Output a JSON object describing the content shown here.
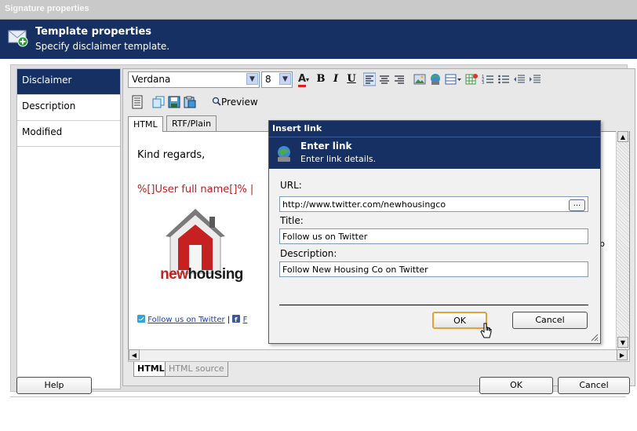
{
  "window": {
    "title": "Signature properties"
  },
  "header": {
    "title": "Template properties",
    "subtitle": "Specify disclaimer template."
  },
  "sidebar": {
    "items": [
      {
        "label": "Disclaimer"
      },
      {
        "label": "Description"
      },
      {
        "label": "Modified"
      }
    ]
  },
  "toolbar": {
    "font": "Verdana",
    "size": "8",
    "bold": "B",
    "italic": "I",
    "underline": "U",
    "preview": "Preview"
  },
  "tabs": {
    "html": "HTML",
    "rtf": "RTF/Plain"
  },
  "editor": {
    "kind_regards": "Kind regards,",
    "user_field": "%[]User full name[]% |",
    "logo_prefix": "new",
    "logo_suffix": "housing",
    "follow_link": "Follow us on Twitter",
    "separator": "|",
    "truncated_link": "F",
    "trailing_char": "p"
  },
  "bottom_tabs": {
    "html": "HTML",
    "source": "HTML source"
  },
  "dialog": {
    "title": "Insert link",
    "heading": "Enter link",
    "subheading": "Enter link details.",
    "url_label": "URL:",
    "url_value": "http://www.twitter.com/newhousingco",
    "browse_label": "...",
    "title_label": "Title:",
    "title_value": "Follow us on Twitter",
    "description_label": "Description:",
    "description_value": "Follow New Housing Co on Twitter",
    "ok": "OK",
    "cancel": "Cancel"
  },
  "footer": {
    "help": "Help",
    "ok": "OK",
    "cancel": "Cancel"
  },
  "colors": {
    "navy": "#163063",
    "red_text": "#c41a1a",
    "logo_red": "#c62020",
    "link_blue": "#1a3fb3",
    "focus_orange": "#e3a13a"
  }
}
